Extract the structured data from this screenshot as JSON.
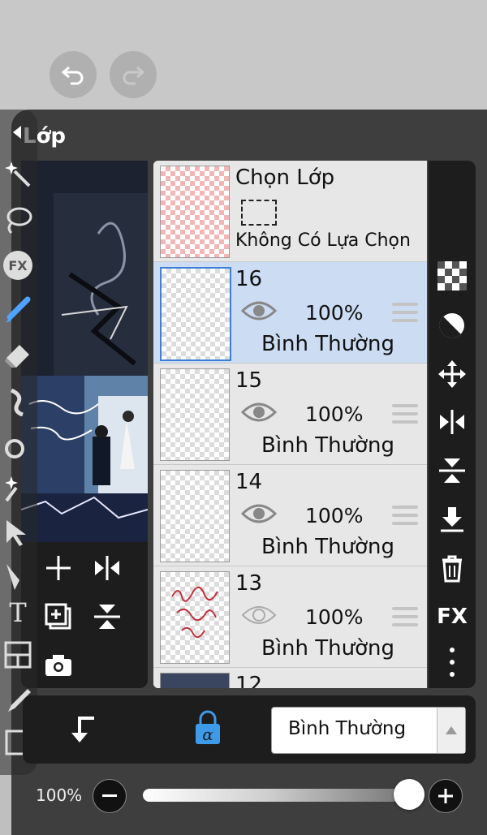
{
  "panel": {
    "title": "Lớp"
  },
  "select_layer": {
    "title": "Chọn Lớp",
    "subtitle": "Không Có Lựa Chọn"
  },
  "layers": [
    {
      "name": "16",
      "opacity": "100%",
      "blend": "Bình Thường",
      "visible": true,
      "selected": true
    },
    {
      "name": "15",
      "opacity": "100%",
      "blend": "Bình Thường",
      "visible": true,
      "selected": false
    },
    {
      "name": "14",
      "opacity": "100%",
      "blend": "Bình Thường",
      "visible": true,
      "selected": false
    },
    {
      "name": "13",
      "opacity": "100%",
      "blend": "Bình Thường",
      "visible": false,
      "selected": false
    },
    {
      "name": "12"
    }
  ],
  "bottom": {
    "blend_mode": "Bình Thường"
  },
  "opacity_bar": {
    "label": "100%",
    "value": 1.0
  },
  "right_tools": {
    "fx_label": "FX"
  },
  "left_tools": {
    "fx_label": "FX",
    "text_label": "T"
  },
  "colors": {
    "accent": "#3d7fd6",
    "selected_row": "#cbdcf3",
    "panel_dark": "#1d1d1d"
  }
}
